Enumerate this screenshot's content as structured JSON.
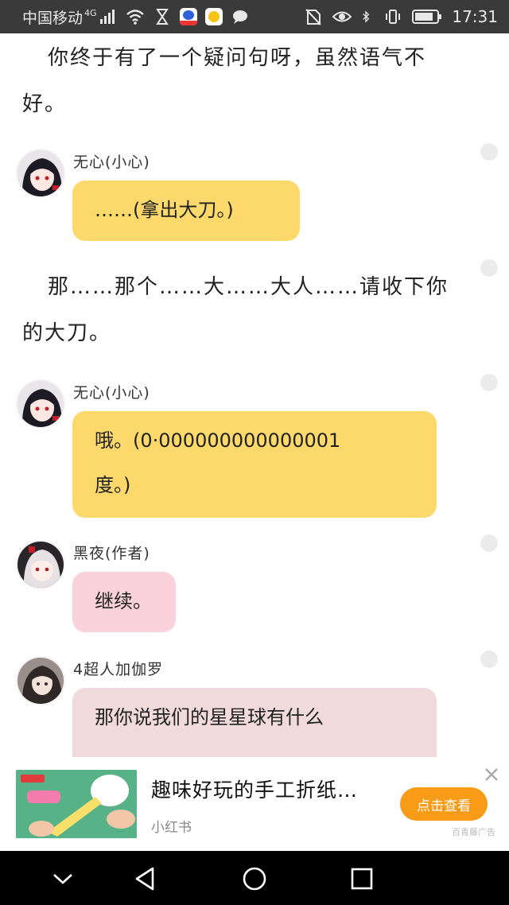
{
  "status_bar": {
    "carrier": "中国移动",
    "network": "4G",
    "time": "17:31"
  },
  "paragraphs": [
    {
      "text": "你终于有了一个疑问句呀，虽然语气不好。"
    },
    {
      "text": "那……那个……大……大人……请收下你的大刀。"
    }
  ],
  "messages": [
    {
      "author": "无心(小心)",
      "text": "……(拿出大刀。)",
      "bubble_color": "#fdd96c"
    },
    {
      "author": "无心(小心)",
      "text_line1": "哦。(0·000000000000001",
      "text_line2": "度。)",
      "bubble_color": "#fdd96c"
    },
    {
      "author": "黑夜(作者)",
      "text": "继续。",
      "bubble_color": "#fbd2dc"
    },
    {
      "author": "4超人加伽罗",
      "text": "那你说我们的星星球有什么",
      "bubble_color": "#f1dadb"
    }
  ],
  "ad": {
    "title": "趣味好玩的手工折纸…",
    "source": "小红书",
    "button_label": "点击查看",
    "tag": "百青藤广告",
    "button_color": "#f89b17"
  },
  "colors": {
    "status_bar_bg": "#3a3a3a",
    "nav_bar_bg": "#000000",
    "bubble_yellow": "#fdd96c",
    "bubble_pink": "#fbd2dc"
  }
}
